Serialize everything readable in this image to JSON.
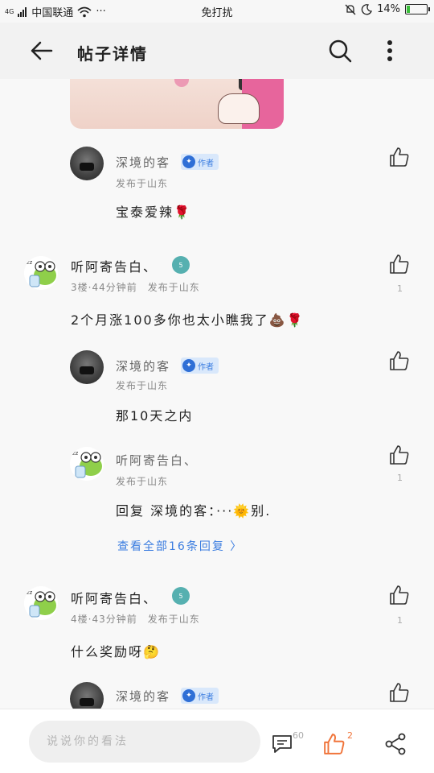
{
  "status_bar": {
    "network": "4G",
    "carrier": "中国联通",
    "dots": "···",
    "mode": "免打扰",
    "battery": "14%"
  },
  "header": {
    "title": "帖子详情"
  },
  "comments": [
    {
      "user": "深境的客",
      "author_badge": "作者",
      "meta": "发布于山东",
      "text": "宝泰爱辣🌹"
    },
    {
      "user": "听阿寄告白、",
      "level": "5",
      "meta": "3楼·44分钟前　发布于山东",
      "text": "2个月涨100多你也太小瞧我了💩🌹",
      "likes": "1"
    },
    {
      "user": "深境的客",
      "author_badge": "作者",
      "meta": "发布于山东",
      "text": "那10天之内"
    },
    {
      "user": "听阿寄告白、",
      "meta": "发布于山东",
      "text": "回复 深境的客：···🌞别.",
      "likes": "1"
    },
    {
      "more_replies": "查看全部16条回复 〉"
    },
    {
      "user": "听阿寄告白、",
      "level": "5",
      "meta": "4楼·43分钟前　发布于山东",
      "text": "什么奖励呀🤔",
      "likes": "1"
    },
    {
      "user": "深境的客",
      "author_badge": "作者"
    }
  ],
  "bottom_bar": {
    "input_placeholder": "说说你的看法",
    "comment_count": "60",
    "like_count": "2"
  },
  "colors": {
    "accent_blue": "#3b7de0",
    "like_orange": "#f0743a"
  }
}
